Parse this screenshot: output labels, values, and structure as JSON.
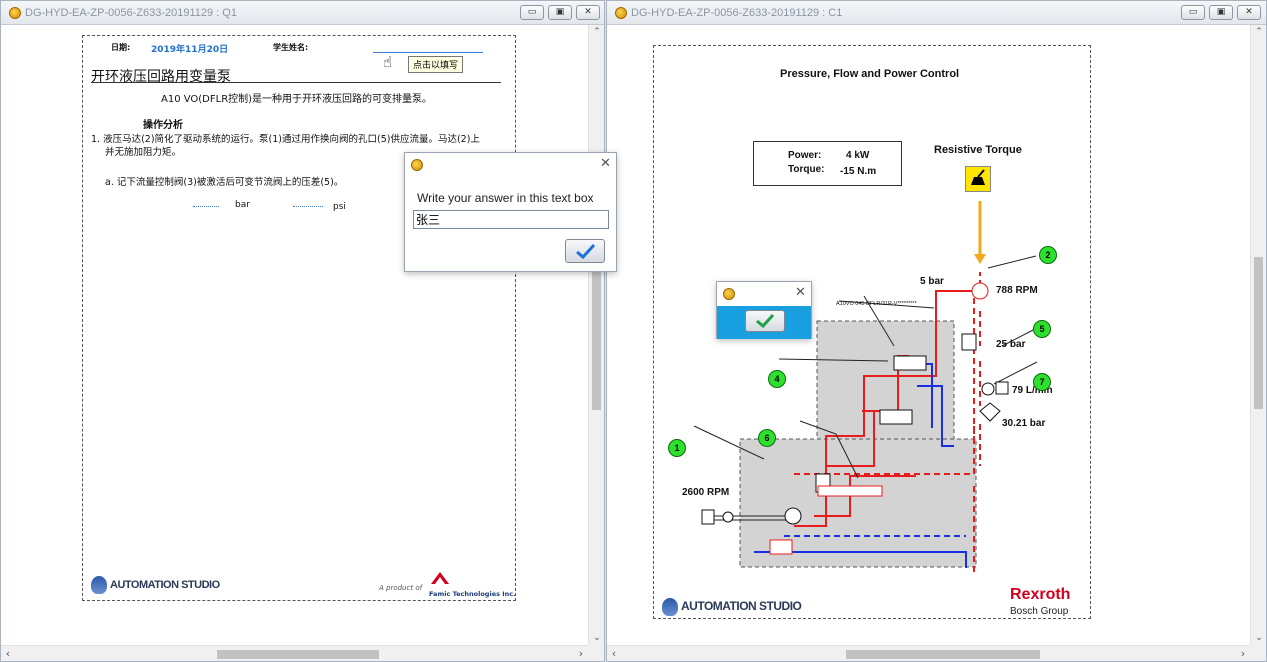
{
  "left_window": {
    "title": "DG-HYD-EA-ZP-0056-Z633-20191129 : Q1",
    "doc": {
      "date_label": "日期:",
      "date_value": "2019年11月20日",
      "student_label": "学生姓名:",
      "title": "开环液压回路用变量泵",
      "subtitle": "A10 VO(DFLR控制)是一种用于开环液压回路的可变排量泵。",
      "section": "操作分析",
      "item1_line1": "1. 液压马达(2)简化了驱动系统的运行。泵(1)通过用作换向阀的孔口(5)供应流量。马达(2)上",
      "item1_line2": "并无施加阻力矩。",
      "item_a": "a. 记下流量控制阀(3)被激活后可变节流阀上的压差(5)。",
      "unit1": "bar",
      "unit2": "psi",
      "tooltip": "点击以填写",
      "footer_logo": "AUTOMATION STUDIO",
      "footer_product": "A product of",
      "footer_company": "Famic Technologies Inc."
    }
  },
  "answer_dialog": {
    "prompt": "Write your answer in this text box",
    "value": "张三"
  },
  "right_window": {
    "title": "DG-HYD-EA-ZP-0056-Z633-20191129 : C1",
    "schematic": {
      "title": "Pressure, Flow and Power Control",
      "power_label": "Power:",
      "power_value": "4 kW",
      "torque_label": "Torque:",
      "torque_value": "-15 N.m",
      "resistive_torque": "Resistive Torque",
      "pressure_5bar": "5 bar",
      "rpm_motor": "788 RPM",
      "pressure_25bar": "25 bar",
      "flow": "79 L/min",
      "pressure_30": "30.21 bar",
      "rpm_pump": "2600 RPM",
      "pump_code": "A10VO 045 DFLR/31R-V*********",
      "badges": [
        "2",
        "5",
        "7",
        "4",
        "6",
        "1"
      ],
      "footer_logo": "AUTOMATION STUDIO",
      "brand_1": "Rexroth",
      "brand_2": "Bosch Group"
    }
  },
  "colors": {
    "pressure_line": "#e81c1c",
    "return_line": "#1a2fe0",
    "badge": "#2ee02e",
    "housing": "#d3d3d3",
    "brand": "#d1001c",
    "date": "#1f6fd1"
  }
}
